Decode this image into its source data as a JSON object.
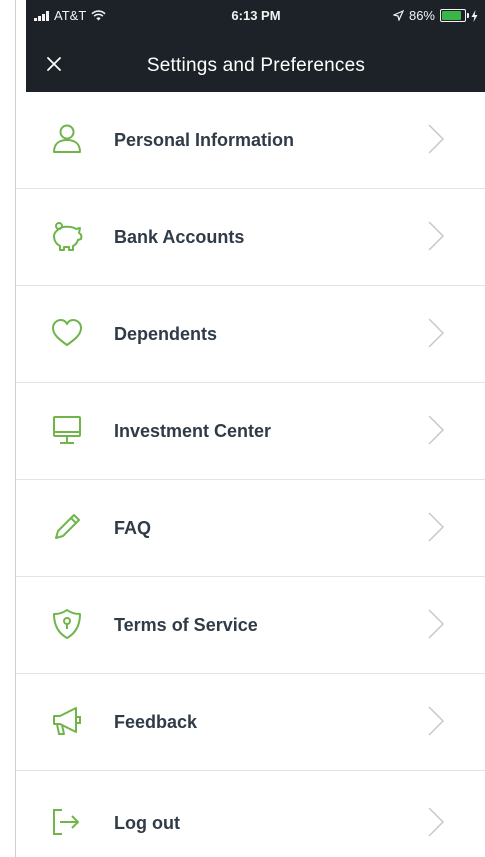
{
  "status_bar": {
    "carrier": "AT&T",
    "time": "6:13 PM",
    "battery_percent": "86%",
    "battery_level": 0.86
  },
  "header": {
    "title": "Settings and Preferences",
    "close_icon": "close-icon"
  },
  "menu": {
    "items": [
      {
        "label": "Personal Information",
        "icon": "person-icon"
      },
      {
        "label": "Bank Accounts",
        "icon": "piggy-bank-icon"
      },
      {
        "label": "Dependents",
        "icon": "heart-icon"
      },
      {
        "label": "Investment Center",
        "icon": "monitor-icon"
      },
      {
        "label": "FAQ",
        "icon": "pencil-icon"
      },
      {
        "label": "Terms of Service",
        "icon": "shield-icon"
      },
      {
        "label": "Feedback",
        "icon": "megaphone-icon"
      },
      {
        "label": "Log out",
        "icon": "logout-icon"
      }
    ]
  },
  "colors": {
    "header_bg": "#1d2228",
    "icon_green": "#6fb54a",
    "label_text": "#2f3b47",
    "chevron": "#c8c8c8",
    "battery_green": "#39b54a"
  }
}
